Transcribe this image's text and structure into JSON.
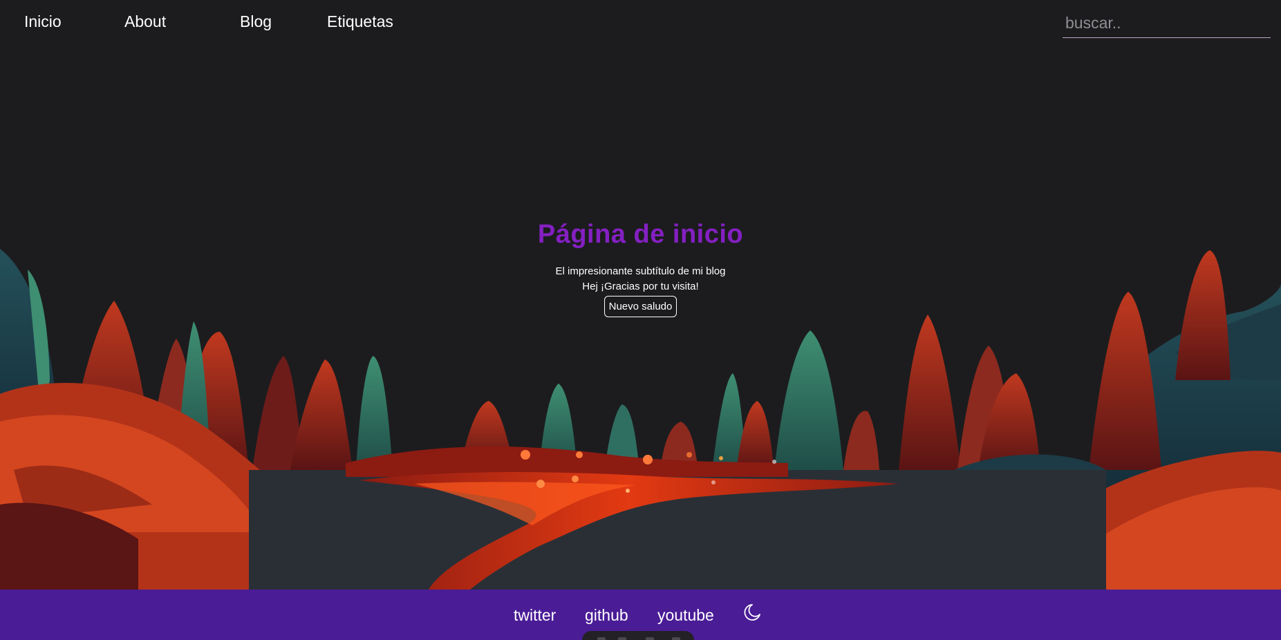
{
  "nav": {
    "items": [
      {
        "label": "Inicio"
      },
      {
        "label": "About"
      },
      {
        "label": "Blog"
      },
      {
        "label": "Etiquetas"
      }
    ],
    "search": {
      "placeholder": "buscar.."
    }
  },
  "hero": {
    "title": "Página de inicio",
    "subtitle": "El impresionante subtítulo de mi blog",
    "greeting": "Hej ¡Gracias por tu visita!",
    "button_label": "Nuevo saludo"
  },
  "footer": {
    "links": [
      {
        "label": "twitter"
      },
      {
        "label": "github"
      },
      {
        "label": "youtube"
      }
    ],
    "theme_toggle_icon": "moon-icon"
  },
  "colors": {
    "background": "#1c1c1e",
    "accent": "#8420c2",
    "footer": "#4a1c96",
    "text": "#ffffff"
  }
}
